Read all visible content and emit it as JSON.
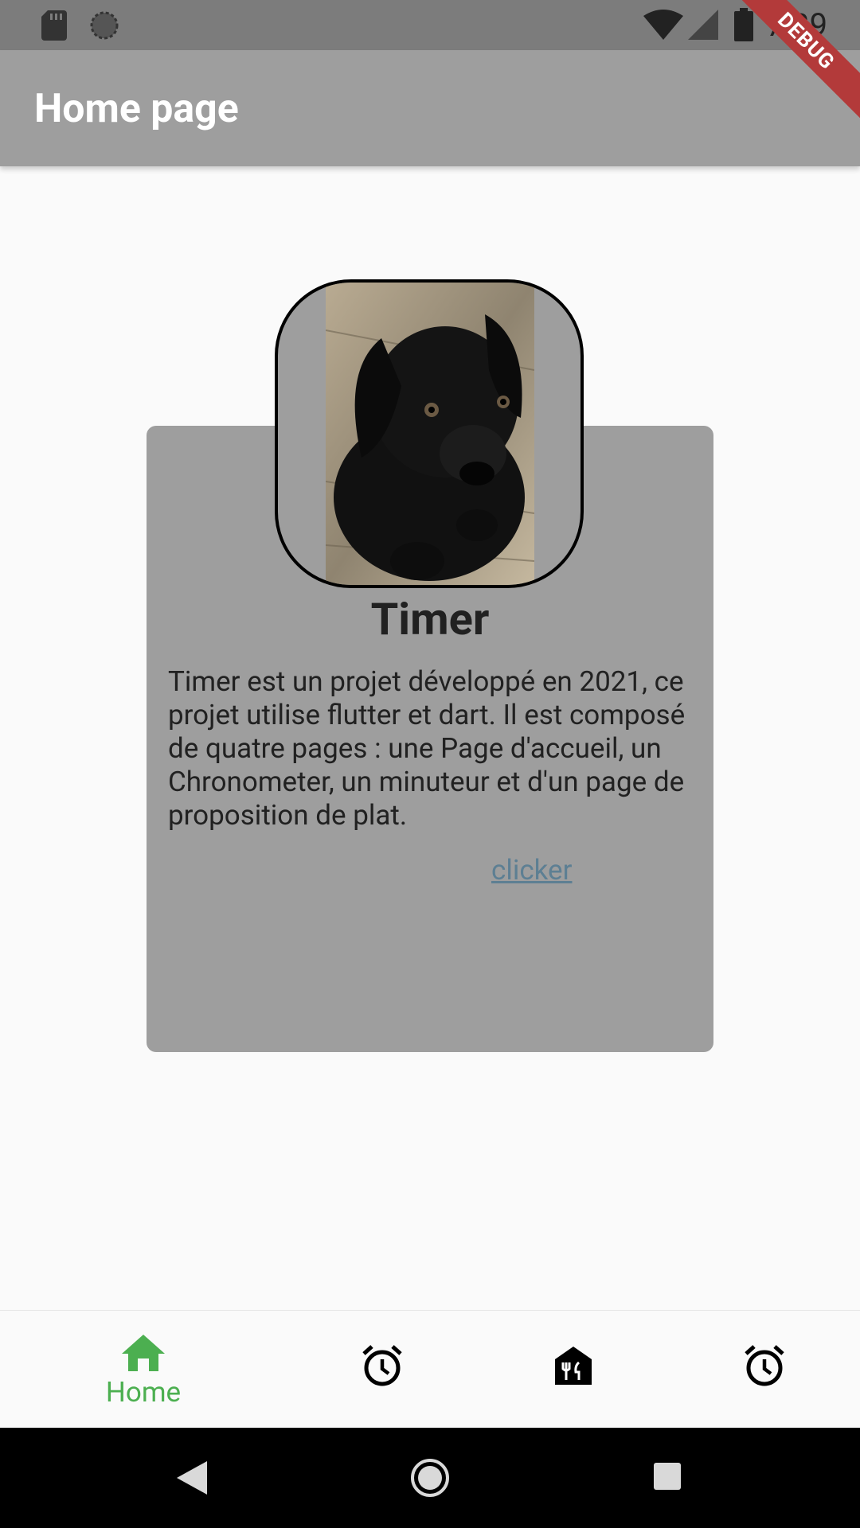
{
  "status_bar": {
    "time": "7:39",
    "icons": [
      "sd-card-icon",
      "sync-icon",
      "wifi-icon",
      "signal-icon",
      "battery-icon"
    ]
  },
  "debug_banner": "DEBUG",
  "app_bar": {
    "title": "Home page"
  },
  "card": {
    "image": "black-puppy-photo",
    "title": "Timer",
    "description": "Timer est un projet développé en 2021, ce projet utilise flutter et dart. Il est composé de quatre pages : une Page d'accueil, un Chronometer, un minuteur et d'un page de proposition de plat.",
    "link_label": "clicker"
  },
  "bottom_nav": {
    "items": [
      {
        "label": "Home",
        "icon": "home-icon",
        "active": true
      },
      {
        "label": "",
        "icon": "alarm-icon",
        "active": false
      },
      {
        "label": "",
        "icon": "restaurant-icon",
        "active": false
      },
      {
        "label": "",
        "icon": "alarm-icon",
        "active": false
      }
    ],
    "active_color": "#4caf50",
    "inactive_color": "#000000"
  },
  "system_nav": {
    "icons": [
      "back-icon",
      "home-circle-icon",
      "recents-icon"
    ]
  }
}
